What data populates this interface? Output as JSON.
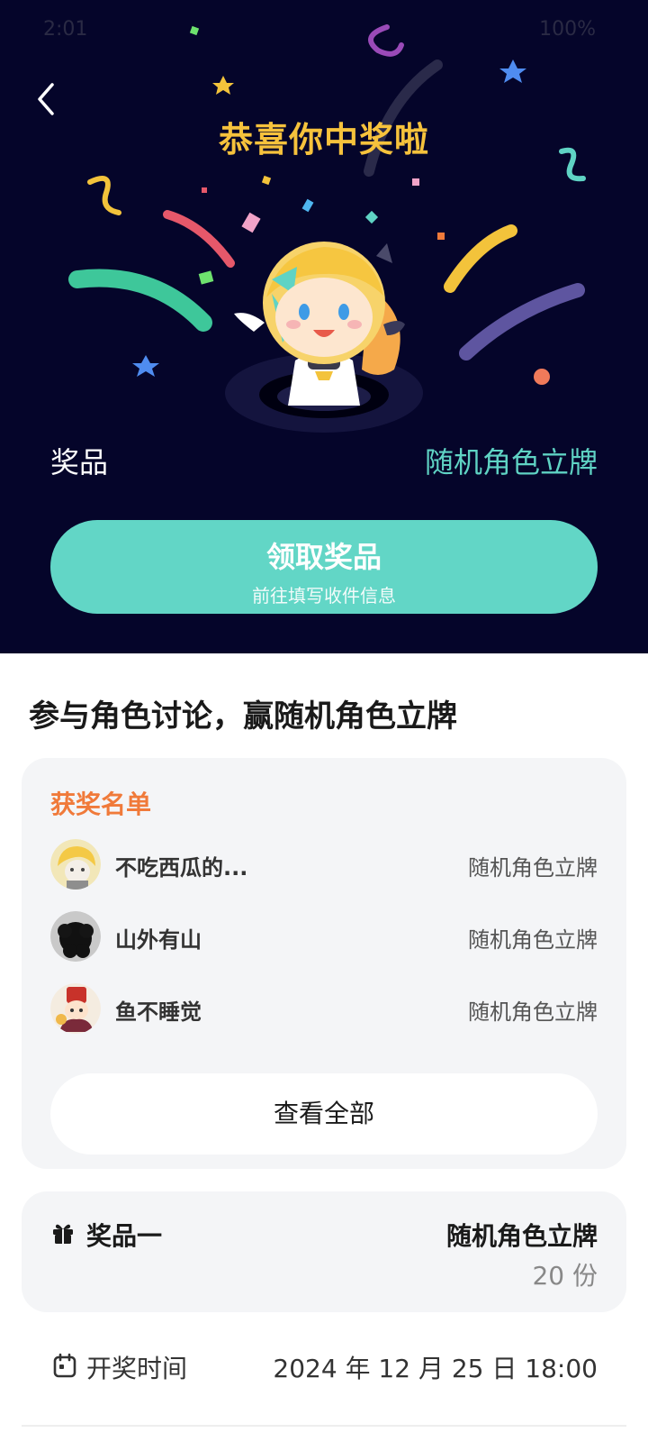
{
  "status_bar": {
    "time": "2:01",
    "right": "100%"
  },
  "header": {
    "title": "恭喜你中奖啦"
  },
  "prize": {
    "label": "奖品",
    "value": "随机角色立牌"
  },
  "claim_button": {
    "title": "领取奖品",
    "subtitle": "前往填写收件信息"
  },
  "section_title": "参与角色讨论，赢随机角色立牌",
  "winners": {
    "heading": "获奖名单",
    "items": [
      {
        "name": "不吃西瓜的...",
        "prize": "随机角色立牌"
      },
      {
        "name": "山外有山",
        "prize": "随机角色立牌"
      },
      {
        "name": "鱼不睡觉",
        "prize": "随机角色立牌"
      }
    ],
    "view_all_label": "查看全部"
  },
  "prize_card": {
    "label": "奖品一",
    "value": "随机角色立牌",
    "count": "20 份"
  },
  "draw": {
    "label": "开奖时间",
    "value": "2024 年 12 月 25 日 18:00"
  },
  "colors": {
    "hero_bg": "#05052a",
    "title": "#f6c23c",
    "accent_teal": "#62d6c6",
    "winners_heading": "#f07a3a"
  },
  "icons": [
    "back-icon",
    "gift-icon",
    "calendar-icon"
  ]
}
